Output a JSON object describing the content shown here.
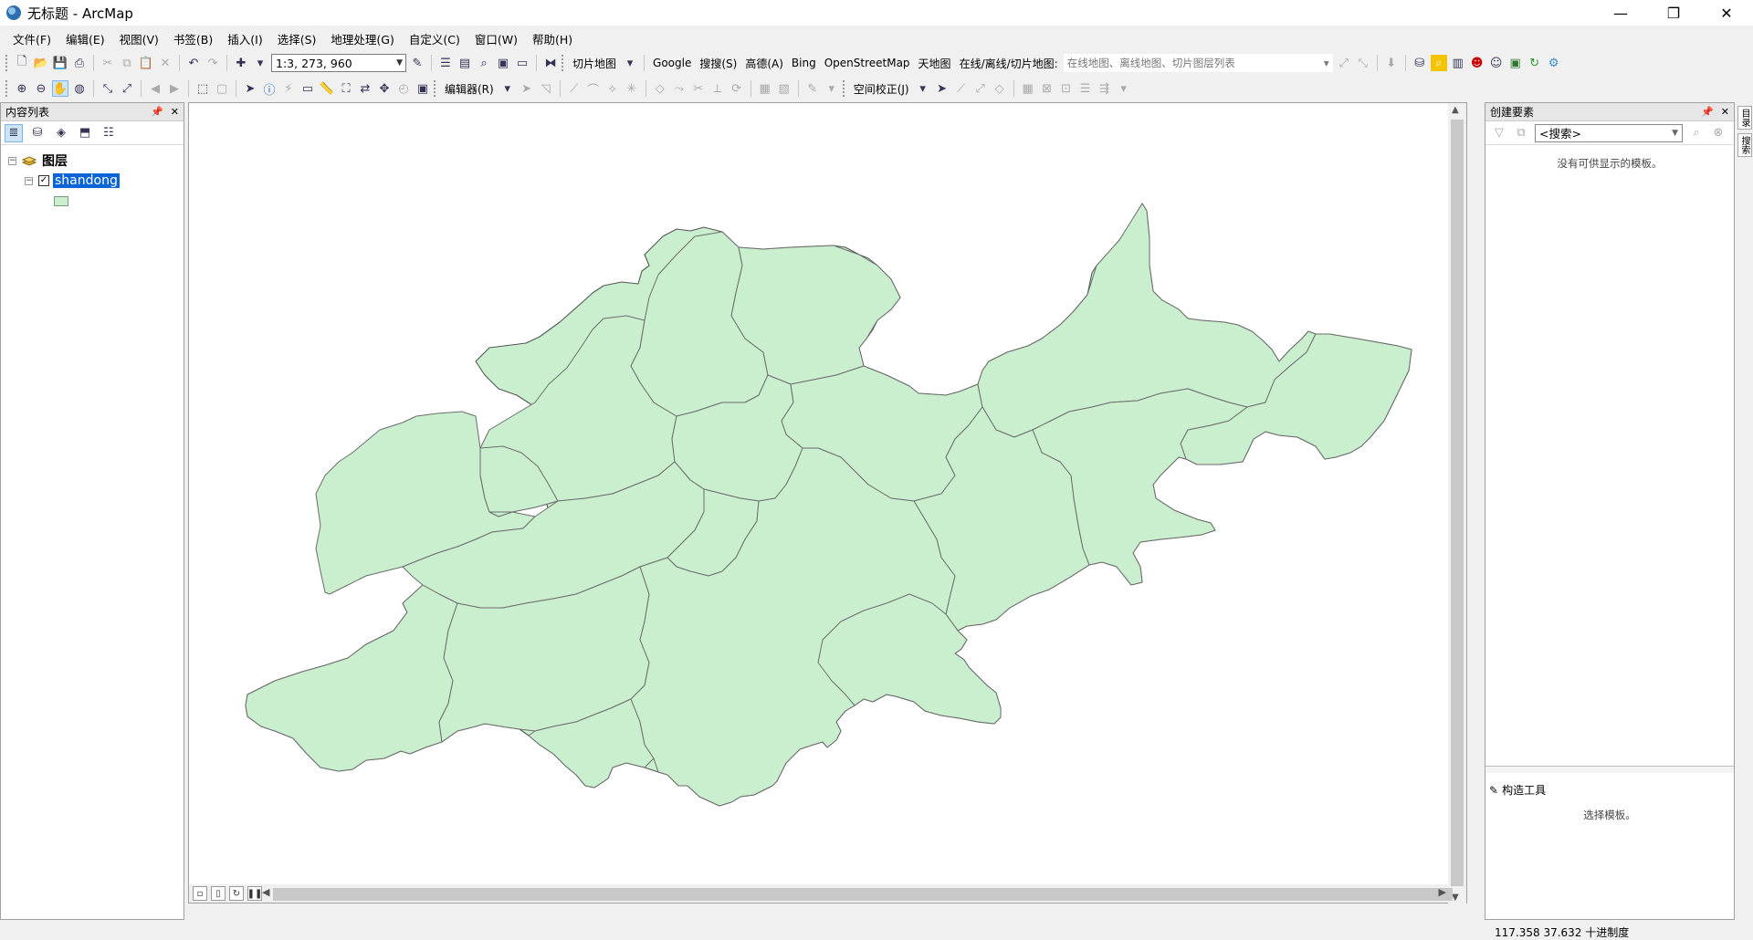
{
  "window": {
    "title": "无标题 - ArcMap",
    "minimize": "—",
    "restore": "❐",
    "close": "✕"
  },
  "menu": [
    "文件(F)",
    "编辑(E)",
    "视图(V)",
    "书签(B)",
    "插入(I)",
    "选择(S)",
    "地理处理(G)",
    "自定义(C)",
    "窗口(W)",
    "帮助(H)"
  ],
  "toolbar1": {
    "scale": "1:3, 273, 960",
    "tile_map": "切片地图",
    "google": "Google",
    "sousou": "搜搜(S)",
    "gaode": "高德(A)",
    "bing": "Bing",
    "osm": "OpenStreetMap",
    "tianditu": "天地图",
    "online_label": "在线/离线/切片地图:",
    "online_value": "在线地图、离线地图、切片图层列表"
  },
  "toolbar2": {
    "editor": "编辑器(R)",
    "spatial_adjust": "空间校正(J)"
  },
  "toc": {
    "title": "内容列表",
    "group": "图层",
    "layer": "shandong",
    "layer_checked": "✓"
  },
  "create": {
    "title": "创建要素",
    "search_placeholder": "<搜索>",
    "empty_msg": "没有可供显示的模板。",
    "construct_title": "构造工具",
    "construct_msg": "选择模板。"
  },
  "side_tabs": [
    "目录",
    "搜索"
  ],
  "status": {
    "coords": "117.358  37.632 十进制度"
  },
  "colors": {
    "fill": "#c9efcf",
    "selection": "#0a64d8"
  }
}
